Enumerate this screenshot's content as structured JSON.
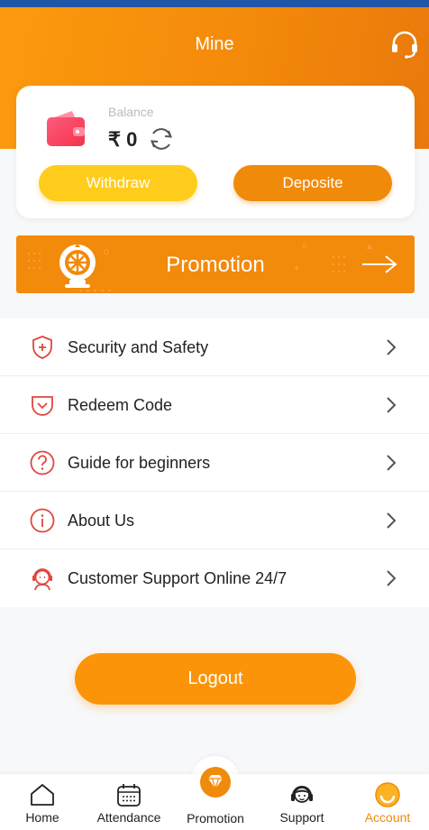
{
  "header": {
    "title": "Mine",
    "support_icon": "headset-icon"
  },
  "balance": {
    "label": "Balance",
    "currency": "₹",
    "amount": "0",
    "withdraw_label": "Withdraw",
    "deposit_label": "Deposite"
  },
  "promotion_banner": {
    "label": "Promotion"
  },
  "menu": [
    {
      "label": "Security and Safety",
      "icon": "shield-plus-icon"
    },
    {
      "label": "Redeem Code",
      "icon": "pocket-icon"
    },
    {
      "label": "Guide for beginners",
      "icon": "question-icon"
    },
    {
      "label": "About Us",
      "icon": "info-icon"
    },
    {
      "label": "Customer Support Online 24/7",
      "icon": "agent-icon"
    }
  ],
  "logout_label": "Logout",
  "tabbar": [
    {
      "label": "Home",
      "icon": "home-icon"
    },
    {
      "label": "Attendance",
      "icon": "calendar-icon"
    },
    {
      "label": "Promotion",
      "icon": "diamond-icon"
    },
    {
      "label": "Support",
      "icon": "support-agent-icon"
    },
    {
      "label": "Account",
      "icon": "account-icon",
      "active": true
    }
  ],
  "colors": {
    "brand_orange": "#f48a0a",
    "withdraw_yellow": "#ffcc1c",
    "menu_icon_red": "#e2463f"
  }
}
